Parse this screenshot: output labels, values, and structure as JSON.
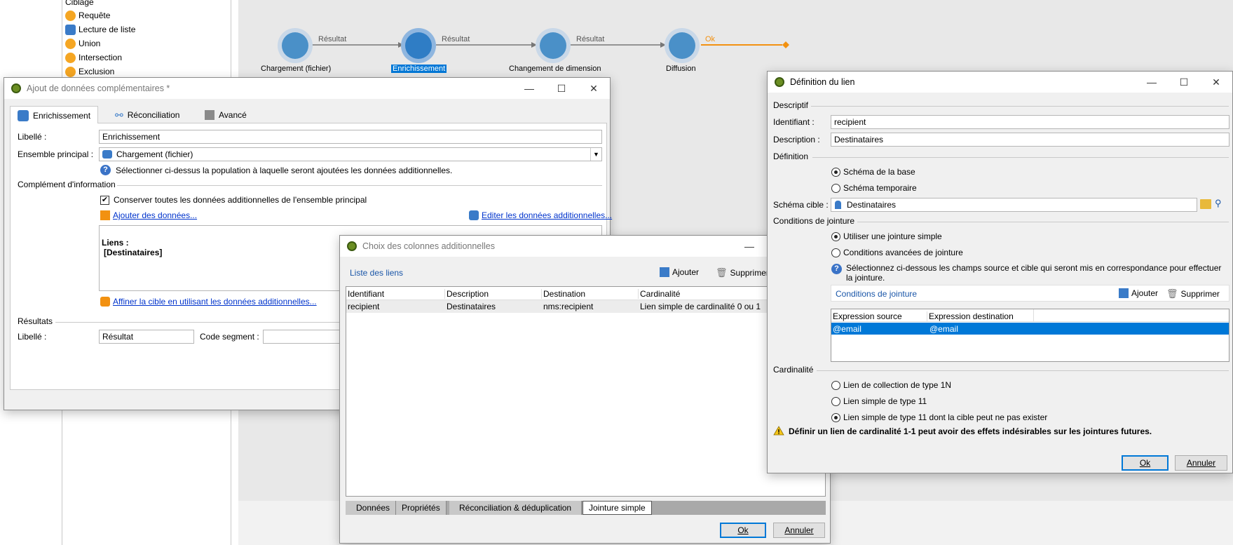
{
  "palette": {
    "header": "Ciblage",
    "items": [
      {
        "label": "Requête",
        "icon": "query-icon"
      },
      {
        "label": "Lecture de liste",
        "icon": "list-read-icon"
      },
      {
        "label": "Union",
        "icon": "union-icon"
      },
      {
        "label": "Intersection",
        "icon": "intersection-icon"
      },
      {
        "label": "Exclusion",
        "icon": "exclusion-icon"
      }
    ]
  },
  "workflow": {
    "nodes": [
      {
        "label": "Chargement (fichier)"
      },
      {
        "label": "Enrichissement"
      },
      {
        "label": "Changement de dimension"
      },
      {
        "label": "Diffusion"
      }
    ],
    "edges": [
      "Résultat",
      "Résultat",
      "Résultat",
      "Ok"
    ]
  },
  "enrich_window": {
    "title": "Ajout de données complémentaires *",
    "tabs": [
      "Enrichissement",
      "Réconciliation",
      "Avancé"
    ],
    "libelle_label": "Libellé :",
    "libelle_value": "Enrichissement",
    "ensemble_label": "Ensemble principal :",
    "ensemble_value": "Chargement (fichier)",
    "help_text": "Sélectionner ci-dessus la population à laquelle seront ajoutées les données additionnelles.",
    "complement_section": "Complément d'information",
    "keep_checkbox": "Conserver toutes les données additionnelles de l'ensemble principal",
    "add_data_link": "Ajouter des données...",
    "edit_data_link": "Editer les données additionnelles...",
    "links_title": "Liens :",
    "links_value": "[Destinataires]",
    "refine_link": "Affiner la cible en utilisant les données additionnelles...",
    "results_section": "Résultats",
    "result_label": "Libellé :",
    "result_value": "Résultat",
    "segment_label": "Code segment :"
  },
  "columns_window": {
    "title": "Choix des colonnes additionnelles",
    "list_title": "Liste des liens",
    "add_label": "Ajouter",
    "delete_label": "Supprimer",
    "headers": [
      "Identifiant",
      "Description",
      "Destination",
      "Cardinalité"
    ],
    "rows": [
      [
        "recipient",
        "Destinataires",
        "nms:recipient",
        "Lien simple de cardinalité 0 ou 1"
      ]
    ],
    "bottom_tabs": [
      "Données",
      "Propriétés",
      "Réconciliation & déduplication",
      "Jointure simple"
    ],
    "active_tab": "Jointure simple",
    "ok": "Ok",
    "cancel": "Annuler"
  },
  "link_window": {
    "title": "Définition du lien",
    "descriptif_section": "Descriptif",
    "id_label": "Identifiant :",
    "id_value": "recipient",
    "desc_label": "Description :",
    "desc_value": "Destinataires",
    "definition_section": "Définition",
    "schema_options": [
      "Schéma de la base",
      "Schéma temporaire"
    ],
    "schema_selected": 0,
    "target_label": "Schéma cible :",
    "target_value": "Destinataires",
    "join_section": "Conditions de jointure",
    "join_options": [
      "Utiliser une jointure simple",
      "Conditions avancées de jointure"
    ],
    "join_selected": 0,
    "join_help": "Sélectionnez ci-dessous les champs source et cible qui seront mis en correspondance pour effectuer la jointure.",
    "join_list_title": "Conditions de jointure",
    "add_label": "Ajouter",
    "delete_label": "Supprimer",
    "join_headers": [
      "Expression source",
      "Expression destination"
    ],
    "join_rows": [
      [
        "@email",
        "@email"
      ]
    ],
    "cardinality_section": "Cardinalité",
    "cardinality_options": [
      "Lien de collection de type 1N",
      "Lien simple de type 11",
      "Lien simple de type 11 dont la cible peut ne pas exister"
    ],
    "cardinality_selected": 2,
    "warning": "Définir un lien de cardinalité 1-1 peut avoir des effets indésirables sur les jointures futures.",
    "ok": "Ok",
    "cancel": "Annuler"
  },
  "colors": {
    "selection": "#0078d7",
    "node": "#4a90c8",
    "edge_ok": "#f29111",
    "link": "#0033cc"
  }
}
